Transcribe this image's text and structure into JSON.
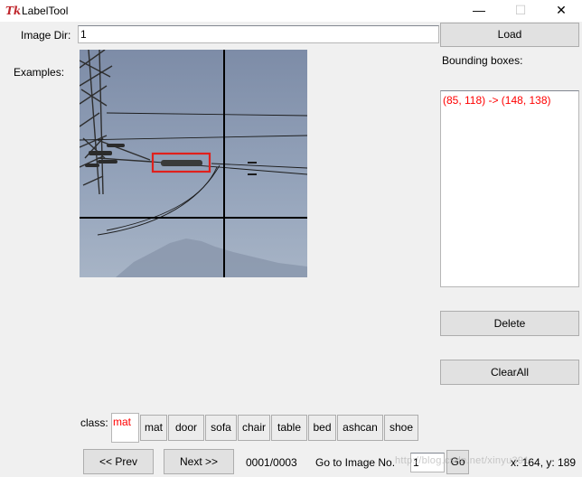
{
  "window": {
    "title": "LabelTool",
    "icon": "tk-feather-icon"
  },
  "titlebar_buttons": {
    "minimize": "—",
    "maximize": "☐",
    "close": "✕"
  },
  "image_dir": {
    "label": "Image Dir:",
    "value": "1"
  },
  "load_button": "Load",
  "examples_label": "Examples:",
  "bounding_boxes": {
    "label": "Bounding boxes:",
    "items": [
      "(85, 118) -> (148, 138)"
    ],
    "color": "#ff0000"
  },
  "delete_button": "Delete",
  "clear_all_button": "ClearAll",
  "class_panel": {
    "label": "class:",
    "current_value": "mat",
    "buttons": [
      "mat",
      "door",
      "sofa",
      "chair",
      "table",
      "bed",
      "ashcan",
      "shoe"
    ]
  },
  "nav": {
    "prev": "<< Prev",
    "next": "Next >>",
    "progress": "0001/0003",
    "goto_label": "Go to Image No.",
    "goto_value": "1",
    "go": "Go",
    "cursor_readout": "x: 164, y: 189"
  },
  "watermark": "http://blog.csdn.net/xinyu391",
  "canvas": {
    "box_color": "#e0201c",
    "crosshair_color": "#000000"
  }
}
